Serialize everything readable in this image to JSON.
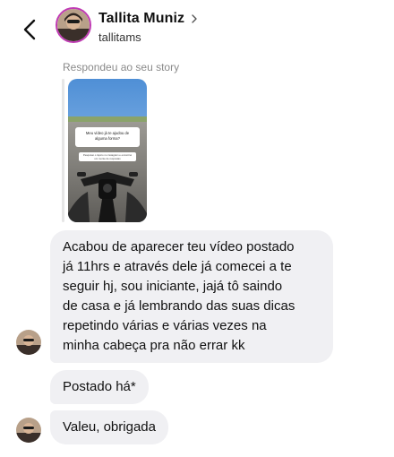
{
  "header": {
    "name": "Tallita Muniz",
    "username": "tallitams",
    "back_icon": "chevron-left-icon",
    "chevron_icon": "chevron-right-icon"
  },
  "story_reply": {
    "caption": "Respondeu ao seu story",
    "thumbnail": {
      "question": "Meu vídeo já te ajudou de alguma forma?",
      "answer": "Pesquisei o tópico no instagram e encontrei um monte de respostas 👍"
    }
  },
  "messages": [
    {
      "lines": [
        "Acabou de aparecer teu vídeo postado",
        "já 11hrs e através dele já comecei a te",
        "seguir hj,  sou iniciante, jajá tô saindo",
        "de casa e já lembrando das suas dicas",
        "repetindo várias e várias vezes na",
        "minha cabeça pra não errar kk"
      ]
    },
    {
      "text": "Postado há*"
    },
    {
      "text": "Valeu, obrigada"
    }
  ],
  "colors": {
    "bubble": "#f0f0f3",
    "caption": "#8a8a8a",
    "story_ring": "#c03bb4"
  }
}
